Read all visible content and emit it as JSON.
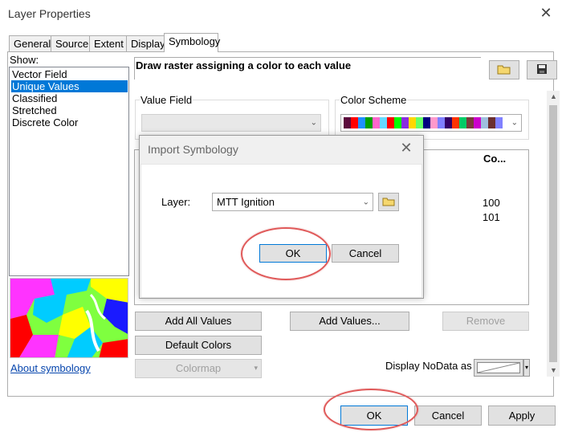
{
  "window": {
    "title": "Layer Properties",
    "close_icon": "close-icon"
  },
  "tabs": [
    {
      "label": "General"
    },
    {
      "label": "Source"
    },
    {
      "label": "Extent"
    },
    {
      "label": "Display"
    },
    {
      "label": "Symbology",
      "active": true
    }
  ],
  "show": {
    "label": "Show:",
    "items": [
      "Vector Field",
      "Unique Values",
      "Classified",
      "Stretched",
      "Discrete Color"
    ],
    "selected": "Unique Values"
  },
  "about_link": "About symbology",
  "header": {
    "description": "Draw raster assigning a color to each value"
  },
  "value_field": {
    "label": "Value Field",
    "value": ""
  },
  "color_scheme": {
    "label": "Color Scheme",
    "swatches": [
      "#5c0a3c",
      "#ff0000",
      "#1e90ff",
      "#00a000",
      "#ff66cc",
      "#66d9ff",
      "#ff0000",
      "#00ff00",
      "#8a2be2",
      "#ffd700",
      "#66ff66",
      "#000080",
      "#ff99cc",
      "#7f7fff",
      "#330066",
      "#ff3300",
      "#00cc66",
      "#7a3b3b",
      "#cc00cc",
      "#9fbfdf",
      "#6b2f2f",
      "#8080ff"
    ]
  },
  "values_table": {
    "column_header": "Co...",
    "values": [
      "100",
      "101"
    ]
  },
  "buttons": {
    "add_all_values": "Add All Values",
    "add_values": "Add Values...",
    "remove": "Remove",
    "default_colors": "Default Colors",
    "colormap": "Colormap"
  },
  "display_nodata": {
    "label": "Display NoData as"
  },
  "bottom": {
    "ok": "OK",
    "cancel": "Cancel",
    "apply": "Apply"
  },
  "dialog": {
    "title": "Import Symbology",
    "layer_label": "Layer:",
    "layer_value": "MTT Ignition",
    "ok": "OK",
    "cancel": "Cancel"
  }
}
